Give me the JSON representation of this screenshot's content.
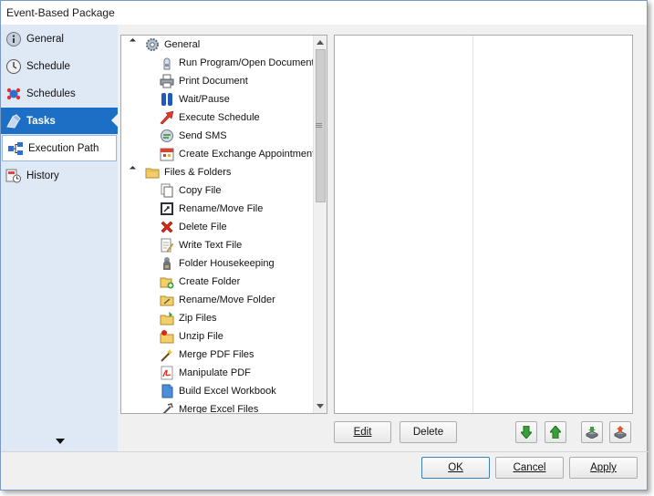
{
  "window": {
    "title": "Event-Based Package"
  },
  "sidebar": {
    "items": [
      {
        "label": "General",
        "icon": "info-icon"
      },
      {
        "label": "Schedule",
        "icon": "clock-icon"
      },
      {
        "label": "Schedules",
        "icon": "schedules-icon"
      },
      {
        "label": "Tasks",
        "icon": "tasks-icon",
        "active": true
      },
      {
        "label": "Execution Path",
        "icon": "execution-path-icon"
      },
      {
        "label": "History",
        "icon": "history-icon"
      }
    ]
  },
  "tree": {
    "groups": [
      {
        "label": "General",
        "icon": "gear-icon",
        "items": [
          {
            "label": "Run Program/Open Document",
            "icon": "run-program-icon"
          },
          {
            "label": "Print Document",
            "icon": "printer-icon"
          },
          {
            "label": "Wait/Pause",
            "icon": "pause-icon"
          },
          {
            "label": "Execute Schedule",
            "icon": "execute-schedule-icon"
          },
          {
            "label": "Send SMS",
            "icon": "sms-icon"
          },
          {
            "label": "Create Exchange Appointment",
            "icon": "calendar-icon"
          }
        ]
      },
      {
        "label": "Files & Folders",
        "icon": "folder-icon",
        "items": [
          {
            "label": "Copy File",
            "icon": "copy-file-icon"
          },
          {
            "label": "Rename/Move File",
            "icon": "rename-file-icon"
          },
          {
            "label": "Delete File",
            "icon": "delete-icon"
          },
          {
            "label": "Write Text File",
            "icon": "write-text-icon"
          },
          {
            "label": "Folder Housekeeping",
            "icon": "housekeeping-icon"
          },
          {
            "label": "Create Folder",
            "icon": "create-folder-icon"
          },
          {
            "label": "Rename/Move Folder",
            "icon": "rename-folder-icon"
          },
          {
            "label": "Zip Files",
            "icon": "zip-icon"
          },
          {
            "label": "Unzip File",
            "icon": "unzip-icon"
          },
          {
            "label": "Merge PDF Files",
            "icon": "merge-pdf-icon"
          },
          {
            "label": "Manipulate PDF",
            "icon": "pdf-icon"
          },
          {
            "label": "Build Excel Workbook",
            "icon": "excel-workbook-icon"
          },
          {
            "label": "Merge Excel Files",
            "icon": "merge-excel-icon"
          }
        ]
      }
    ]
  },
  "task_buttons": {
    "edit": "Edit",
    "delete": "Delete"
  },
  "footer": {
    "ok": "OK",
    "cancel": "Cancel",
    "apply": "Apply"
  }
}
